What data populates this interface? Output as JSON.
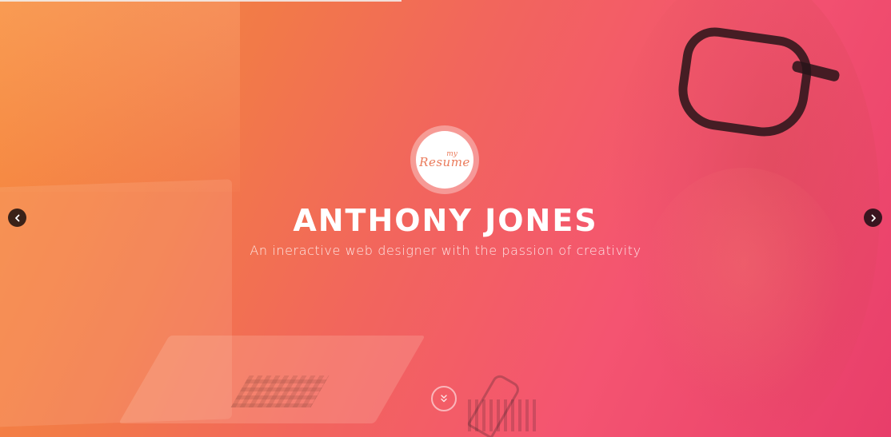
{
  "hero": {
    "logo": {
      "small_text": "my",
      "main_text": "Resume"
    },
    "name": "ANTHONY JONES",
    "tagline": "An ineractive web designer with the passion of creativity"
  },
  "slider": {
    "prev_icon": "chevron-left-icon",
    "next_icon": "chevron-right-icon"
  },
  "scroll": {
    "icon": "double-chevron-down-icon"
  },
  "colors": {
    "gradient_start": "#f78c3c",
    "gradient_mid": "#f2665c",
    "gradient_end": "#e83e6a",
    "logo_text": "#ea7a5a",
    "arrow_bg": "#2a1414",
    "text": "#ffffff"
  }
}
